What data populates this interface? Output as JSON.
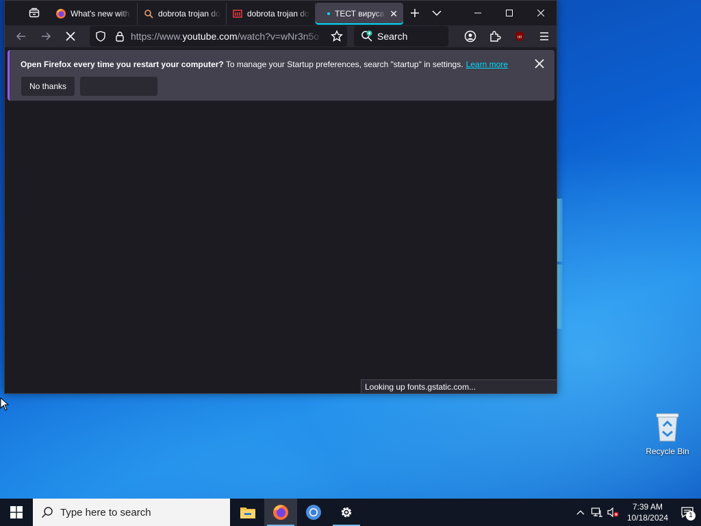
{
  "browser": {
    "tabs": [
      {
        "title": "What's new with",
        "favicon": "firefox-icon"
      },
      {
        "title": "dobrota trojan do",
        "favicon": "search-icon"
      },
      {
        "title": "dobrota trojan do",
        "favicon": "site-red-icon"
      },
      {
        "title": "ТЕСТ вируса о",
        "favicon": "loading-dot-icon"
      }
    ],
    "url_prefix": "https://www.",
    "url_host": "youtube.com",
    "url_path": "/watch?v=wNr3n5o",
    "search_placeholder": "Search",
    "notification": {
      "bold_text": "Open Firefox every time you restart your computer?",
      "text": " To manage your Startup preferences, search \"startup\" in settings.",
      "link": "Learn more",
      "no_thanks": "No thanks"
    },
    "status_text": "Looking up fonts.gstatic.com..."
  },
  "desktop": {
    "recycle_bin_label": "Recycle Bin"
  },
  "taskbar": {
    "search_placeholder": "Type here to search",
    "time": "7:39 AM",
    "date": "10/18/2024",
    "notification_count": "1"
  },
  "colors": {
    "accent": "#00ddff",
    "taskbar": "#101623",
    "browser_bg": "#1c1b22"
  }
}
